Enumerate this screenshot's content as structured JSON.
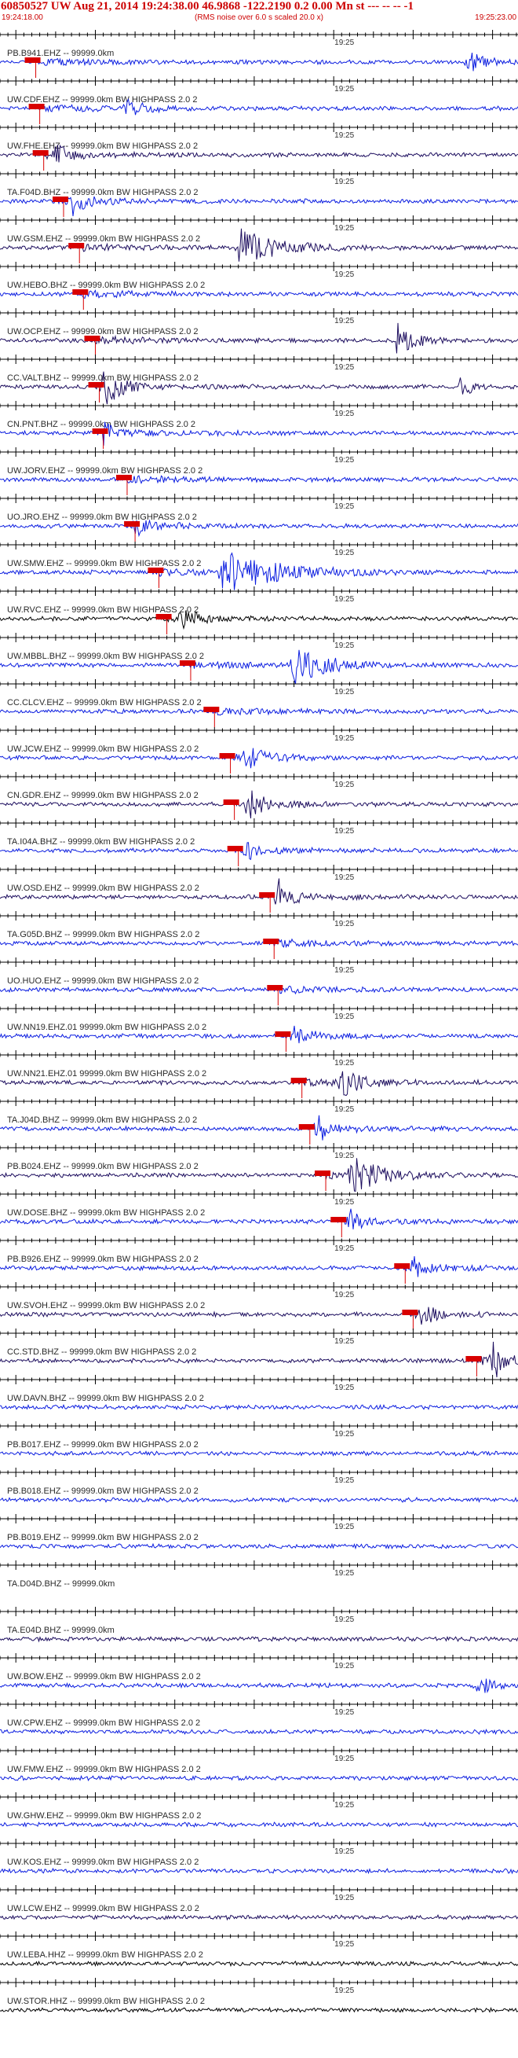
{
  "header": {
    "title": "60850527 UW Aug 21, 2014 19:24:38.00    46.9868 -122.2190  0.2 0.00 Mn st --- -- --   -1",
    "start_time": "19:24:18.00",
    "note": "(RMS noise over 6.0 s scaled 20.0 x)",
    "end_time": "19:25:23.00"
  },
  "colors": {
    "trace_blue": "#0b1de0",
    "trace_dark": "#1c0d5e",
    "trace_black": "#000000",
    "pick_red": "#d80000",
    "axis": "#000000",
    "label": "#2a2a2a"
  },
  "chart_data": {
    "type": "line",
    "title": "",
    "xlabel": "",
    "ylabel": "",
    "time_axis": {
      "start": "19:24:18.00",
      "end": "19:25:23.00",
      "tick_label": "19:25",
      "tick_time": "19:25:00"
    },
    "traces": [
      {
        "label": "PB.B941.EHZ -- 99999.0km",
        "color": "blue",
        "pick_time": "19:24:22.5",
        "bursts": [
          {
            "t": "19:25:17",
            "amp": 0.6,
            "width": 4
          }
        ]
      },
      {
        "label": "UW.CDF.EHZ -- 99999.0km BW  HIGHPASS  2.0  2",
        "color": "blue",
        "pick_time": "19:24:23",
        "bursts": [
          {
            "t": "19:24:34",
            "amp": 0.5,
            "width": 4
          }
        ]
      },
      {
        "label": "UW.FHE.EHZ -- 99999.0km BW  HIGHPASS  2.0  2",
        "color": "dark",
        "pick_time": "19:24:23.5",
        "bursts": [
          {
            "t": "19:24:25",
            "amp": 0.5,
            "width": 3
          }
        ]
      },
      {
        "label": "TA.F04D.BHZ -- 99999.0km BW  HIGHPASS  2.0  2",
        "color": "blue",
        "pick_time": "19:24:26",
        "bursts": [
          {
            "t": "19:24:27",
            "amp": 0.7,
            "width": 3
          }
        ]
      },
      {
        "label": "UW.GSM.EHZ -- 99999.0km BW  HIGHPASS  2.0  2",
        "color": "dark",
        "pick_time": "19:24:28",
        "bursts": [
          {
            "t": "19:24:48",
            "amp": 1.0,
            "width": 10
          }
        ]
      },
      {
        "label": "UW.HEBO.BHZ -- 99999.0km BW  HIGHPASS  2.0  2",
        "color": "blue",
        "pick_time": "19:24:28.5",
        "bursts": []
      },
      {
        "label": "UW.OCP.EHZ -- 99999.0km BW  HIGHPASS  2.0  2",
        "color": "dark",
        "pick_time": "19:24:30",
        "bursts": [
          {
            "t": "19:25:08",
            "amp": 1.0,
            "width": 4
          }
        ]
      },
      {
        "label": "CC.VALT.BHZ -- 99999.0km BW  HIGHPASS  2.0  2",
        "color": "dark",
        "pick_time": "19:24:30.5",
        "bursts": [
          {
            "t": "19:24:31",
            "amp": 1.0,
            "width": 4
          },
          {
            "t": "19:25:16",
            "amp": 0.6,
            "width": 3
          }
        ]
      },
      {
        "label": "CN.PNT.BHZ -- 99999.0km BW  HIGHPASS  2.0  2",
        "color": "blue",
        "pick_time": "19:24:31",
        "bursts": [
          {
            "t": "19:24:31",
            "amp": 0.5,
            "width": 3
          }
        ]
      },
      {
        "label": "UW.JORV.EHZ -- 99999.0km BW  HIGHPASS  2.0  2",
        "color": "blue",
        "pick_time": "19:24:34",
        "bursts": []
      },
      {
        "label": "UO.JRO.EHZ -- 99999.0km BW  HIGHPASS  2.0  2",
        "color": "blue",
        "pick_time": "19:24:35",
        "bursts": [
          {
            "t": "19:24:35",
            "amp": 0.6,
            "width": 2
          }
        ]
      },
      {
        "label": "UW.SMW.EHZ -- 99999.0km BW  HIGHPASS  2.0  2",
        "color": "blue",
        "pick_time": "19:24:38",
        "bursts": [
          {
            "t": "19:24:46",
            "amp": 1.0,
            "width": 16
          }
        ]
      },
      {
        "label": "UW.RVC.EHZ -- 99999.0km BW  HIGHPASS  2.0  2",
        "color": "black",
        "pick_time": "19:24:39",
        "bursts": [
          {
            "t": "19:24:41",
            "amp": 0.6,
            "width": 3
          }
        ]
      },
      {
        "label": "UW.MBBL.BHZ -- 99999.0km BW  HIGHPASS  2.0  2",
        "color": "blue",
        "pick_time": "19:24:42",
        "bursts": [
          {
            "t": "19:24:55",
            "amp": 0.9,
            "width": 9
          }
        ]
      },
      {
        "label": "CC.CLCV.EHZ -- 99999.0km BW  HIGHPASS  2.0  2",
        "color": "blue",
        "pick_time": "19:24:45",
        "bursts": []
      },
      {
        "label": "UW.JCW.EHZ -- 99999.0km BW  HIGHPASS  2.0  2",
        "color": "blue",
        "pick_time": "19:24:47",
        "bursts": [
          {
            "t": "19:24:49",
            "amp": 0.5,
            "width": 5
          }
        ]
      },
      {
        "label": "CN.GDR.EHZ -- 99999.0km BW  HIGHPASS  2.0  2",
        "color": "dark",
        "pick_time": "19:24:47.5",
        "bursts": [
          {
            "t": "19:24:49",
            "amp": 0.8,
            "width": 4
          }
        ]
      },
      {
        "label": "TA.I04A.BHZ -- 99999.0km BW  HIGHPASS  2.0  2",
        "color": "blue",
        "pick_time": "19:24:48",
        "bursts": [
          {
            "t": "19:24:49",
            "amp": 0.6,
            "width": 2
          }
        ]
      },
      {
        "label": "UW.OSD.EHZ -- 99999.0km BW  HIGHPASS  2.0  2",
        "color": "dark",
        "pick_time": "19:24:52",
        "bursts": [
          {
            "t": "19:24:53",
            "amp": 0.9,
            "width": 3
          }
        ]
      },
      {
        "label": "TA.G05D.BHZ -- 99999.0km BW  HIGHPASS  2.0  2",
        "color": "blue",
        "pick_time": "19:24:52.5",
        "bursts": []
      },
      {
        "label": "UO.HUO.EHZ -- 99999.0km BW  HIGHPASS  2.0  2",
        "color": "blue",
        "pick_time": "19:24:53",
        "bursts": []
      },
      {
        "label": "UW.NN19.EHZ.01 99999.0km BW  HIGHPASS  2.0  2",
        "color": "blue",
        "pick_time": "19:24:54",
        "bursts": [
          {
            "t": "19:24:55",
            "amp": 0.5,
            "width": 3
          }
        ]
      },
      {
        "label": "UW.NN21.EHZ.01 99999.0km BW  HIGHPASS  2.0  2",
        "color": "dark",
        "pick_time": "19:24:56",
        "bursts": [
          {
            "t": "19:25:01",
            "amp": 0.7,
            "width": 5
          }
        ]
      },
      {
        "label": "TA.J04D.BHZ -- 99999.0km BW  HIGHPASS  2.0  2",
        "color": "blue",
        "pick_time": "19:24:57",
        "bursts": [
          {
            "t": "19:24:58",
            "amp": 0.6,
            "width": 3
          }
        ]
      },
      {
        "label": "PB.B024.EHZ -- 99999.0km BW  HIGHPASS  2.0  2",
        "color": "dark",
        "pick_time": "19:24:59",
        "bursts": [
          {
            "t": "19:25:02",
            "amp": 0.9,
            "width": 8
          }
        ]
      },
      {
        "label": "UW.DOSE.BHZ -- 99999.0km BW  HIGHPASS  2.0  2",
        "color": "blue",
        "pick_time": "19:25:01",
        "bursts": [
          {
            "t": "19:25:02",
            "amp": 0.6,
            "width": 2
          }
        ]
      },
      {
        "label": "PB.B926.EHZ -- 99999.0km BW  HIGHPASS  2.0  2",
        "color": "blue",
        "pick_time": "19:25:09",
        "bursts": [
          {
            "t": "19:25:10",
            "amp": 0.5,
            "width": 3
          }
        ]
      },
      {
        "label": "UW.SVOH.EHZ -- 99999.0km BW  HIGHPASS  2.0  2",
        "color": "dark",
        "pick_time": "19:25:10",
        "bursts": [
          {
            "t": "19:25:11",
            "amp": 0.5,
            "width": 3
          }
        ]
      },
      {
        "label": "CC.STD.BHZ -- 99999.0km BW  HIGHPASS  2.0  2",
        "color": "dark",
        "pick_time": "19:25:18",
        "bursts": [
          {
            "t": "19:25:20",
            "amp": 1.0,
            "width": 3
          }
        ]
      },
      {
        "label": "UW.DAVN.BHZ -- 99999.0km BW  HIGHPASS  2.0  2",
        "color": "blue",
        "pick_time": "",
        "bursts": []
      },
      {
        "label": "PB.B017.EHZ -- 99999.0km BW  HIGHPASS  2.0  2",
        "color": "blue",
        "pick_time": "",
        "bursts": []
      },
      {
        "label": "PB.B018.EHZ -- 99999.0km BW  HIGHPASS  2.0  2",
        "color": "blue",
        "pick_time": "",
        "bursts": []
      },
      {
        "label": "PB.B019.EHZ -- 99999.0km BW  HIGHPASS  2.0  2",
        "color": "blue",
        "pick_time": "",
        "bursts": []
      },
      {
        "label": "TA.D04D.BHZ -- 99999.0km",
        "color": "none",
        "pick_time": "",
        "bursts": []
      },
      {
        "label": "TA.E04D.BHZ -- 99999.0km",
        "color": "dark",
        "pick_time": "",
        "bursts": []
      },
      {
        "label": "UW.BOW.EHZ -- 99999.0km BW  HIGHPASS  2.0  2",
        "color": "blue",
        "pick_time": "",
        "bursts": [
          {
            "t": "19:25:18",
            "amp": 0.5,
            "width": 4
          }
        ]
      },
      {
        "label": "UW.CPW.EHZ -- 99999.0km BW  HIGHPASS  2.0  2",
        "color": "blue",
        "pick_time": "",
        "bursts": []
      },
      {
        "label": "UW.FMW.EHZ -- 99999.0km BW  HIGHPASS  2.0  2",
        "color": "blue",
        "pick_time": "",
        "bursts": []
      },
      {
        "label": "UW.GHW.EHZ -- 99999.0km BW  HIGHPASS  2.0  2",
        "color": "blue",
        "pick_time": "",
        "bursts": []
      },
      {
        "label": "UW.KOS.EHZ -- 99999.0km BW  HIGHPASS  2.0  2",
        "color": "blue",
        "pick_time": "",
        "bursts": []
      },
      {
        "label": "UW.LCW.EHZ -- 99999.0km BW  HIGHPASS  2.0  2",
        "color": "dark",
        "pick_time": "",
        "bursts": []
      },
      {
        "label": "UW.LEBA.HHZ -- 99999.0km BW  HIGHPASS  2.0  2",
        "color": "black",
        "pick_time": "",
        "bursts": []
      },
      {
        "label": "UW.STOR.HHZ -- 99999.0km BW  HIGHPASS  2.0  2",
        "color": "black",
        "pick_time": "",
        "bursts": []
      }
    ]
  }
}
